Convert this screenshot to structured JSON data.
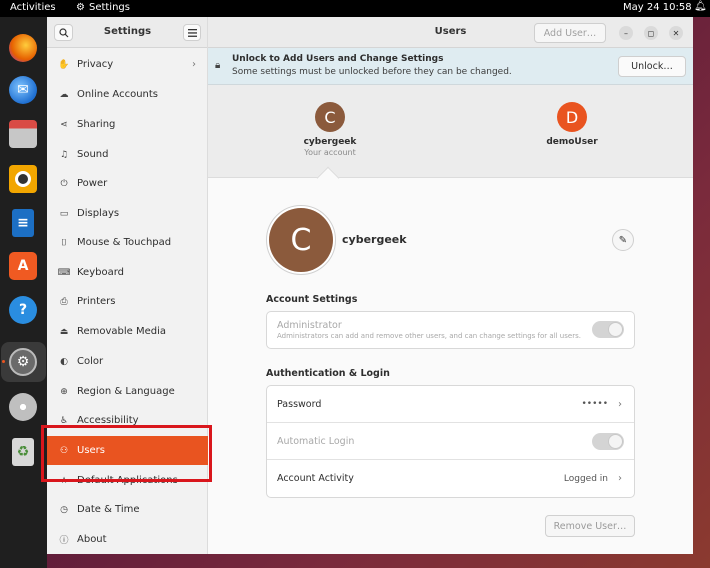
{
  "topbar": {
    "activities": "Activities",
    "app_name": "Settings",
    "clock": "May 24  10:58"
  },
  "dock": {
    "items": [
      {
        "name": "firefox",
        "color": "#e66000"
      },
      {
        "name": "thunderbird",
        "color": "#1f6fd1"
      },
      {
        "name": "files",
        "color": "#c7403b"
      },
      {
        "name": "rhythmbox",
        "color": "#f2a600"
      },
      {
        "name": "libreoffice-writer",
        "color": "#1c6fc4"
      },
      {
        "name": "ubuntu-software",
        "color": "#f05a22"
      },
      {
        "name": "help",
        "color": "#2a8de0"
      },
      {
        "name": "settings",
        "color": "#808080"
      },
      {
        "name": "dvd",
        "color": "#bfbfbf"
      },
      {
        "name": "trash",
        "color": "#4a8e3a"
      }
    ]
  },
  "sidebar": {
    "title": "Settings",
    "items": [
      {
        "label": "Privacy",
        "icon": "hand-icon",
        "glyph": "✋",
        "chevron": true
      },
      {
        "label": "Online Accounts",
        "icon": "cloud-icon",
        "glyph": "☁"
      },
      {
        "label": "Sharing",
        "icon": "share-icon",
        "glyph": "⋖"
      },
      {
        "label": "Sound",
        "icon": "music-note-icon",
        "glyph": "♫"
      },
      {
        "label": "Power",
        "icon": "power-icon",
        "glyph": "⏻"
      },
      {
        "label": "Displays",
        "icon": "display-icon",
        "glyph": "▭"
      },
      {
        "label": "Mouse & Touchpad",
        "icon": "mouse-icon",
        "glyph": "⌷"
      },
      {
        "label": "Keyboard",
        "icon": "keyboard-icon",
        "glyph": "⌨"
      },
      {
        "label": "Printers",
        "icon": "printer-icon",
        "glyph": "⎙"
      },
      {
        "label": "Removable Media",
        "icon": "removable-media-icon",
        "glyph": "⏏"
      },
      {
        "label": "Color",
        "icon": "color-icon",
        "glyph": "◐"
      },
      {
        "label": "Region & Language",
        "icon": "globe-icon",
        "glyph": "⊕"
      },
      {
        "label": "Accessibility",
        "icon": "accessibility-icon",
        "glyph": "♿"
      },
      {
        "label": "Users",
        "icon": "users-icon",
        "glyph": "⚇",
        "active": true
      },
      {
        "label": "Default Applications",
        "icon": "star-icon",
        "glyph": "★"
      },
      {
        "label": "Date & Time",
        "icon": "clock-icon",
        "glyph": "◷"
      },
      {
        "label": "About",
        "icon": "info-icon",
        "glyph": "ⓘ"
      }
    ]
  },
  "main": {
    "title": "Users",
    "add_user_label": "Add User…",
    "unlock_title": "Unlock to Add Users and Change Settings",
    "unlock_subtitle": "Some settings must be unlocked before they can be changed.",
    "unlock_button": "Unlock…",
    "carousel": [
      {
        "initial": "C",
        "name": "cybergeek",
        "sub": "Your account",
        "color": "#8b5a3c"
      },
      {
        "initial": "D",
        "name": "demoUser",
        "sub": "",
        "color": "#e95420"
      }
    ],
    "profile": {
      "initial": "C",
      "name": "cybergeek"
    },
    "account_settings_title": "Account Settings",
    "administrator_label": "Administrator",
    "administrator_desc": "Administrators can add and remove other users, and can change settings for all users.",
    "auth_title": "Authentication & Login",
    "password_label": "Password",
    "password_value": "•••••",
    "auto_login_label": "Automatic Login",
    "activity_label": "Account Activity",
    "activity_value": "Logged in",
    "remove_user": "Remove User…"
  },
  "colors": {
    "accent": "#e95420",
    "highlight_box": "#d9161c"
  }
}
